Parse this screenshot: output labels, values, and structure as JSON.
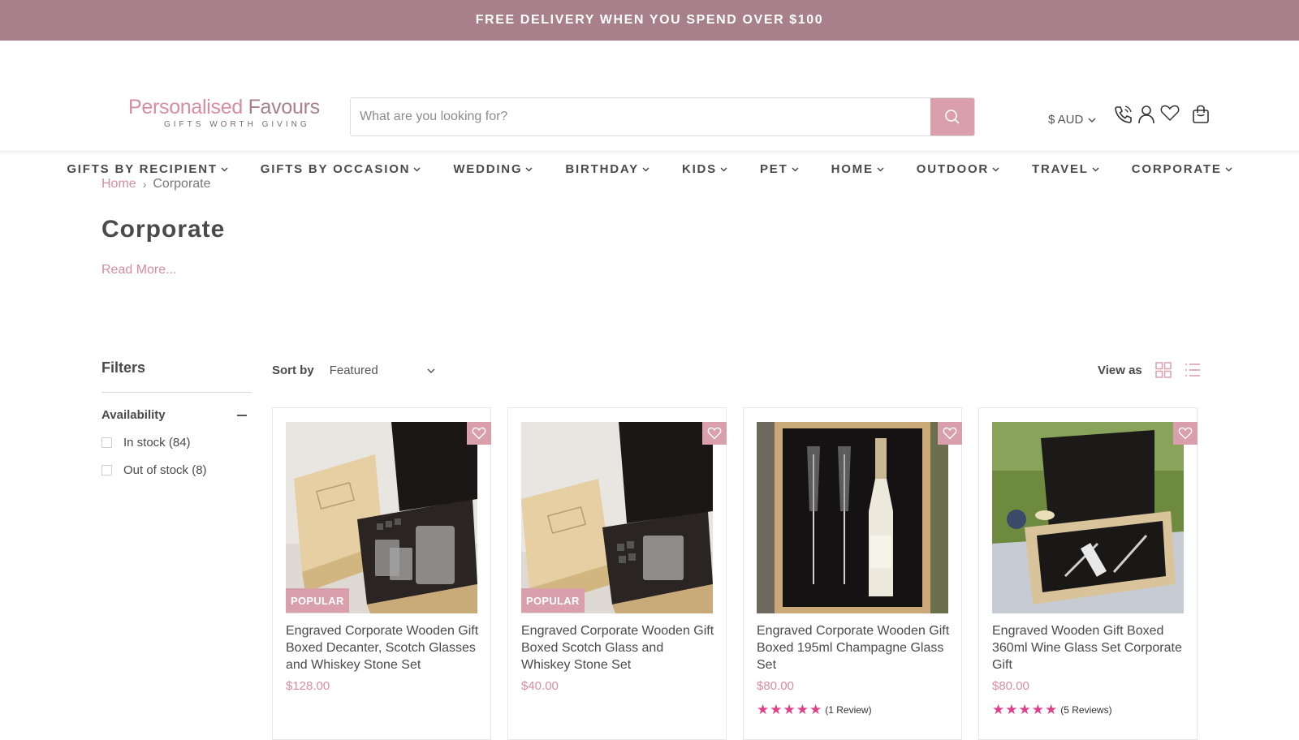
{
  "announcement": "FREE DELIVERY WHEN YOU SPEND OVER $100",
  "logo": {
    "part1": "Personalised",
    "part2": " Favours",
    "tagline": "GIFTS WORTH GIVING"
  },
  "search": {
    "placeholder": "What are you looking for?"
  },
  "currency": "$ AUD",
  "header_icons": [
    "phone-icon",
    "account-icon",
    "wishlist-icon",
    "cart-icon"
  ],
  "nav": [
    "GIFTS BY RECIPIENT",
    "GIFTS BY OCCASION",
    "WEDDING",
    "BIRTHDAY",
    "KIDS",
    "PET",
    "HOME",
    "OUTDOOR",
    "TRAVEL",
    "CORPORATE"
  ],
  "breadcrumb": {
    "home": "Home",
    "sep": "›",
    "current": "Corporate"
  },
  "page_title": "Corporate",
  "read_more": "Read More...",
  "filters": {
    "title": "Filters",
    "group": "Availability",
    "options": [
      "In stock (84)",
      "Out of stock (8)"
    ]
  },
  "sort": {
    "label": "Sort by",
    "value": "Featured"
  },
  "view_as": "View as",
  "products": [
    {
      "name": "Engraved Corporate Wooden Gift Boxed Decanter, Scotch Glasses and Whiskey Stone Set",
      "price": "$128.00",
      "badge": "POPULAR",
      "reviews": ""
    },
    {
      "name": "Engraved Corporate Wooden Gift Boxed Scotch Glass and Whiskey Stone Set",
      "price": "$40.00",
      "badge": "POPULAR",
      "reviews": ""
    },
    {
      "name": "Engraved Corporate Wooden Gift Boxed 195ml Champagne Glass Set",
      "price": "$80.00",
      "badge": "",
      "reviews": "(1 Review)"
    },
    {
      "name": "Engraved Wooden Gift Boxed 360ml Wine Glass Set Corporate Gift",
      "price": "$80.00",
      "badge": "",
      "reviews": "(5 Reviews)"
    }
  ],
  "colors": {
    "accent": "#d9a0ab",
    "announce_bg": "#a7808c",
    "link": "#d58ea0",
    "star": "#e0408a"
  }
}
